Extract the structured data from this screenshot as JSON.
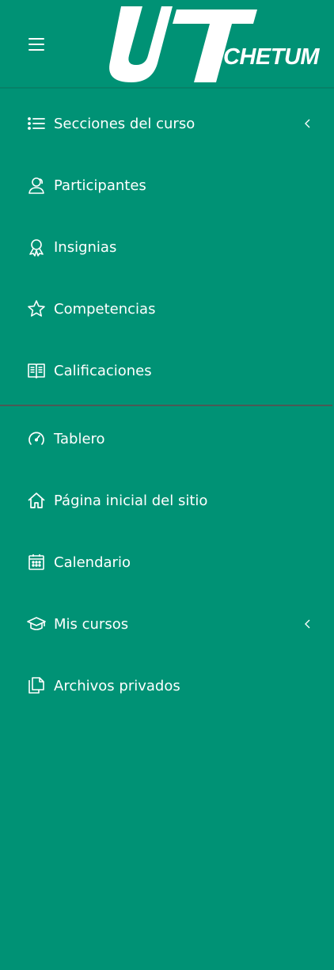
{
  "header": {
    "logo_letters": "UT",
    "logo_text": "CHETUM"
  },
  "course_menu": [
    {
      "label": "Secciones del curso",
      "icon": "list-icon",
      "has_submenu": true
    },
    {
      "label": "Participantes",
      "icon": "users-icon",
      "has_submenu": false
    },
    {
      "label": "Insignias",
      "icon": "badge-icon",
      "has_submenu": false
    },
    {
      "label": "Competencias",
      "icon": "star-icon",
      "has_submenu": false
    },
    {
      "label": "Calificaciones",
      "icon": "book-icon",
      "has_submenu": false
    }
  ],
  "site_menu": [
    {
      "label": "Tablero",
      "icon": "dashboard-icon",
      "has_submenu": false
    },
    {
      "label": "Página inicial del sitio",
      "icon": "home-icon",
      "has_submenu": false
    },
    {
      "label": "Calendario",
      "icon": "calendar-icon",
      "has_submenu": false
    },
    {
      "label": "Mis cursos",
      "icon": "graduation-cap-icon",
      "has_submenu": true
    },
    {
      "label": "Archivos privados",
      "icon": "files-icon",
      "has_submenu": false
    }
  ],
  "colors": {
    "background": "#009275",
    "text": "#ffffff",
    "divider": "#4a5a55"
  }
}
